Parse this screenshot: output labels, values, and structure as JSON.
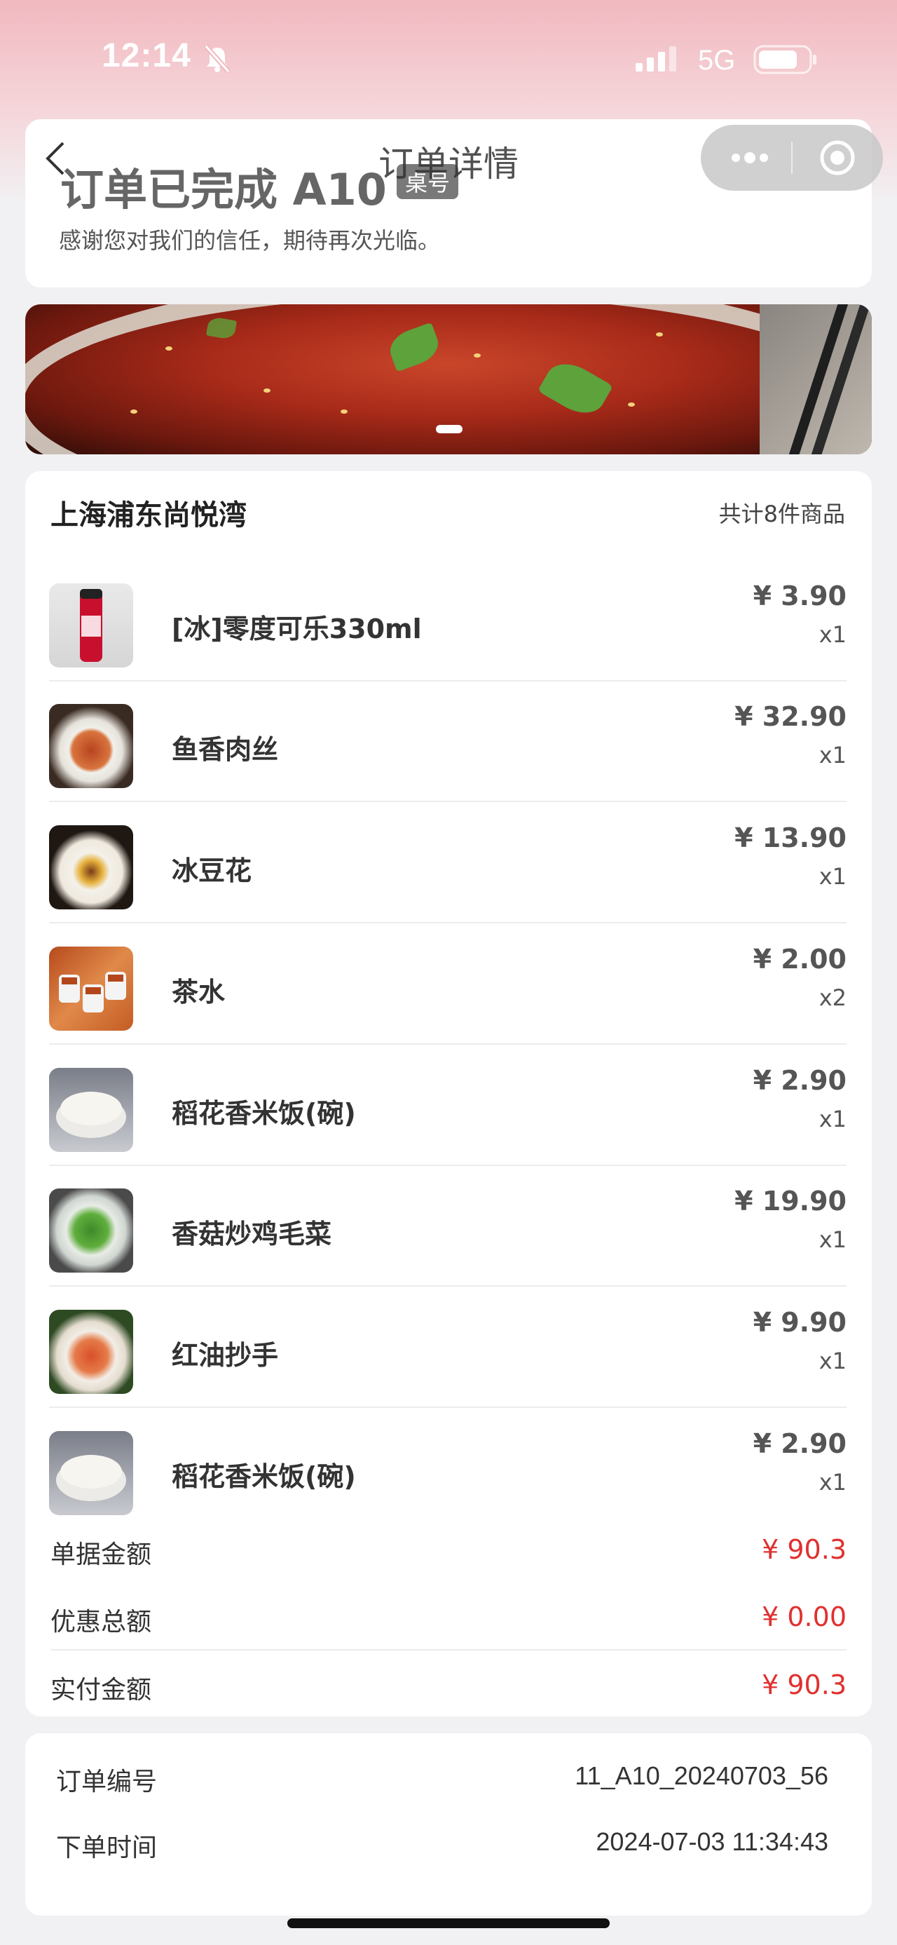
{
  "status_bar": {
    "time": "12:14",
    "network": "5G"
  },
  "nav": {
    "title": "订单详情"
  },
  "order_status": {
    "title": "订单已完成 A10",
    "table_tag": "桌号",
    "message": "感谢您对我们的信任，期待再次光临。"
  },
  "store": {
    "name": "上海浦东尚悦湾",
    "item_count": "共计8件商品"
  },
  "items": [
    {
      "name": "[冰]零度可乐330ml",
      "price": "¥ 3.90",
      "qty": "x1"
    },
    {
      "name": "鱼香肉丝",
      "price": "¥ 32.90",
      "qty": "x1"
    },
    {
      "name": "冰豆花",
      "price": "¥ 13.90",
      "qty": "x1"
    },
    {
      "name": "茶水",
      "price": "¥ 2.00",
      "qty": "x2"
    },
    {
      "name": "稻花香米饭(碗)",
      "price": "¥ 2.90",
      "qty": "x1"
    },
    {
      "name": "香菇炒鸡毛菜",
      "price": "¥ 19.90",
      "qty": "x1"
    },
    {
      "name": "红油抄手",
      "price": "¥ 9.90",
      "qty": "x1"
    },
    {
      "name": "稻花香米饭(碗)",
      "price": "¥ 2.90",
      "qty": "x1"
    }
  ],
  "summary": {
    "bill_label": "单据金额",
    "bill_value": "¥ 90.3",
    "discount_label": "优惠总额",
    "discount_value": "¥ 0.00",
    "paid_label": "实付金额",
    "paid_value": "¥ 90.3"
  },
  "order_info": {
    "number_label": "订单编号",
    "number_value": "11_A10_20240703_56",
    "time_label": "下单时间",
    "time_value": "2024-07-03 11:34:43"
  },
  "colors": {
    "accent_red": "#e0302f",
    "header_pink": "#f1b9c0"
  }
}
